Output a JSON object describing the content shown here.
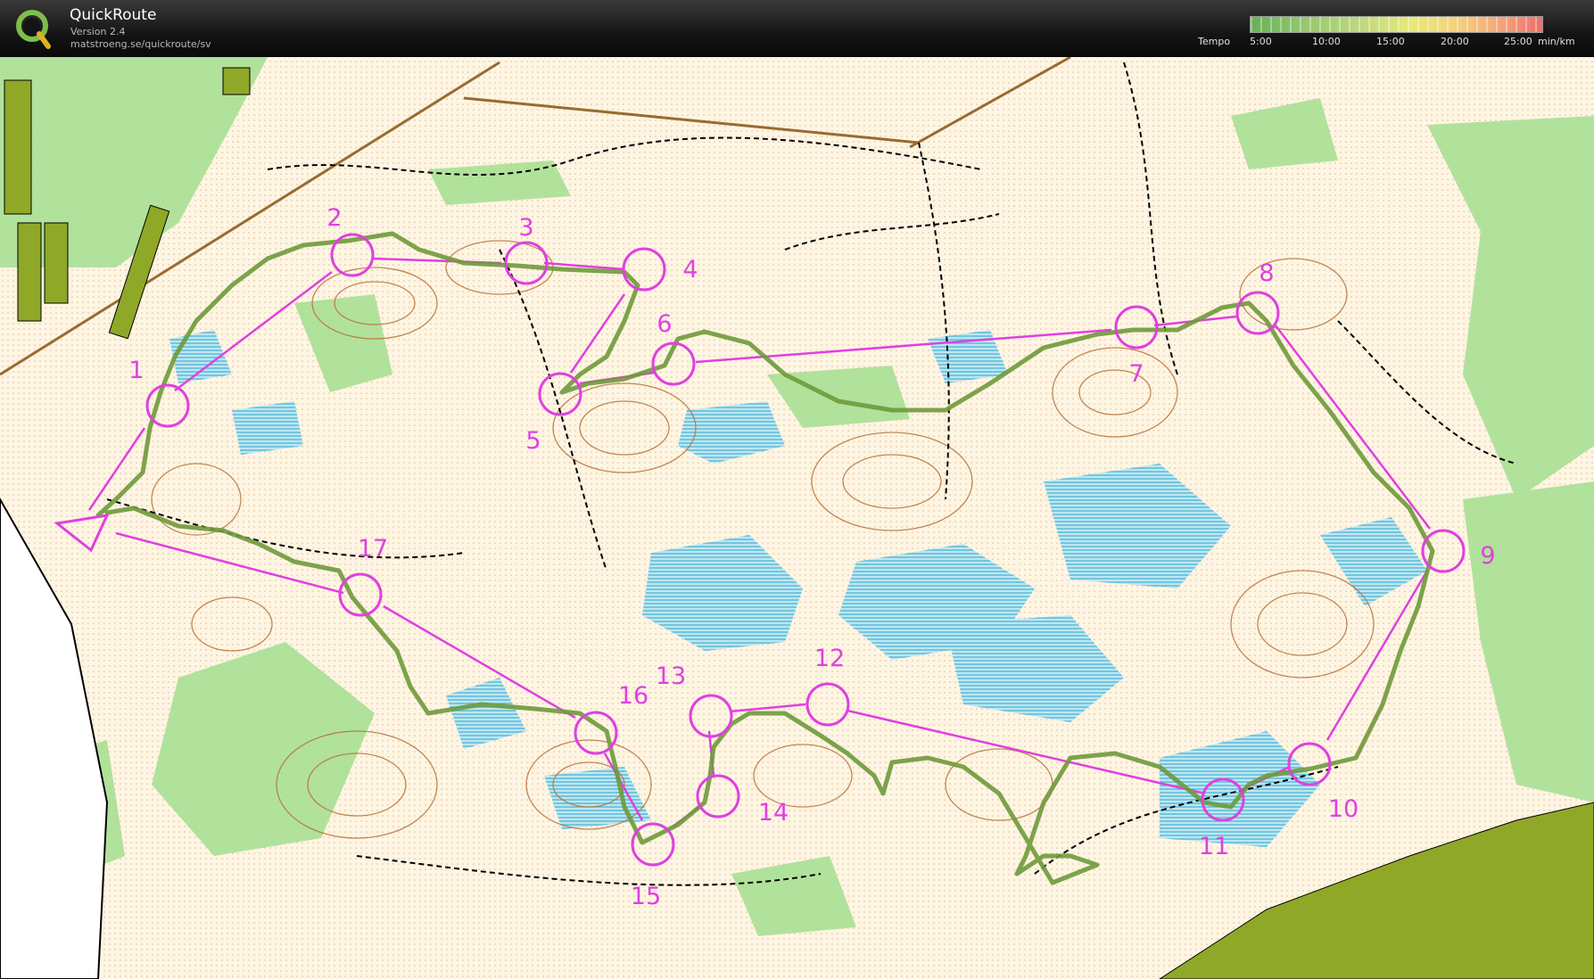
{
  "app": {
    "title": "QuickRoute",
    "version": "Version 2.4",
    "url": "matstroeng.se/quickroute/sv"
  },
  "legend": {
    "label": "Tempo",
    "ticks": [
      "5:00",
      "10:00",
      "15:00",
      "20:00",
      "25:00"
    ],
    "unit": "min/km",
    "colors": [
      "#66b056",
      "#bfd87f",
      "#e9e87b",
      "#f4cf7c",
      "#ee6d6d"
    ]
  },
  "map": {
    "course_color": "#e040e0",
    "route_color": "#6e9a3a",
    "terrain_colors": {
      "open_land": "#fdf0d8",
      "forest": "#ffffff",
      "green": "#9fdc8a",
      "marsh_water": "#5ec0dc",
      "contour": "#b8733a",
      "path": "#000000",
      "settlement": "#8fa828"
    },
    "start": {
      "label": "Start"
    },
    "controls": [
      {
        "label": "1"
      },
      {
        "label": "2"
      },
      {
        "label": "3"
      },
      {
        "label": "4"
      },
      {
        "label": "5"
      },
      {
        "label": "6"
      },
      {
        "label": "7"
      },
      {
        "label": "8"
      },
      {
        "label": "9"
      },
      {
        "label": "10"
      },
      {
        "label": "11"
      },
      {
        "label": "12"
      },
      {
        "label": "13"
      },
      {
        "label": "14"
      },
      {
        "label": "15"
      },
      {
        "label": "16"
      },
      {
        "label": "17"
      }
    ]
  }
}
